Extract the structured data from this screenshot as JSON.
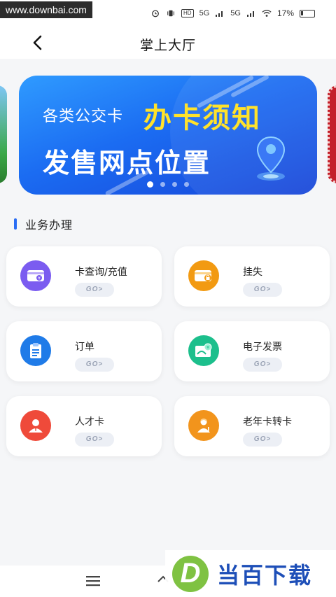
{
  "status_bar": {
    "watermark": "www.downbai.com",
    "network_1": "5G",
    "network_2": "5G",
    "hd_badge": "HD",
    "battery": "17%"
  },
  "header": {
    "title": "掌上大厅"
  },
  "banner": {
    "line1": "各类公交卡",
    "highlight": "办卡须知",
    "line2": "发售网点位置",
    "dot_count": 4,
    "active_dot": 0
  },
  "section": {
    "title": "业务办理"
  },
  "services": [
    {
      "label": "卡查询/充值",
      "go": "GO>",
      "icon": "card-yuan-icon",
      "color": "#7b5cf0"
    },
    {
      "label": "挂失",
      "go": "GO>",
      "icon": "card-lock-icon",
      "color": "#f29a12"
    },
    {
      "label": "订单",
      "go": "GO>",
      "icon": "clipboard-icon",
      "color": "#1f7be8"
    },
    {
      "label": "电子发票",
      "go": "GO>",
      "icon": "invoice-icon",
      "color": "#1cbf8c"
    },
    {
      "label": "人才卡",
      "go": "GO>",
      "icon": "person-icon",
      "color": "#ef4a3a"
    },
    {
      "label": "老年卡转卡",
      "go": "GO>",
      "icon": "elder-icon",
      "color": "#f2941c"
    }
  ],
  "bottom_logo": {
    "letter": "D",
    "text": "当百下载"
  }
}
